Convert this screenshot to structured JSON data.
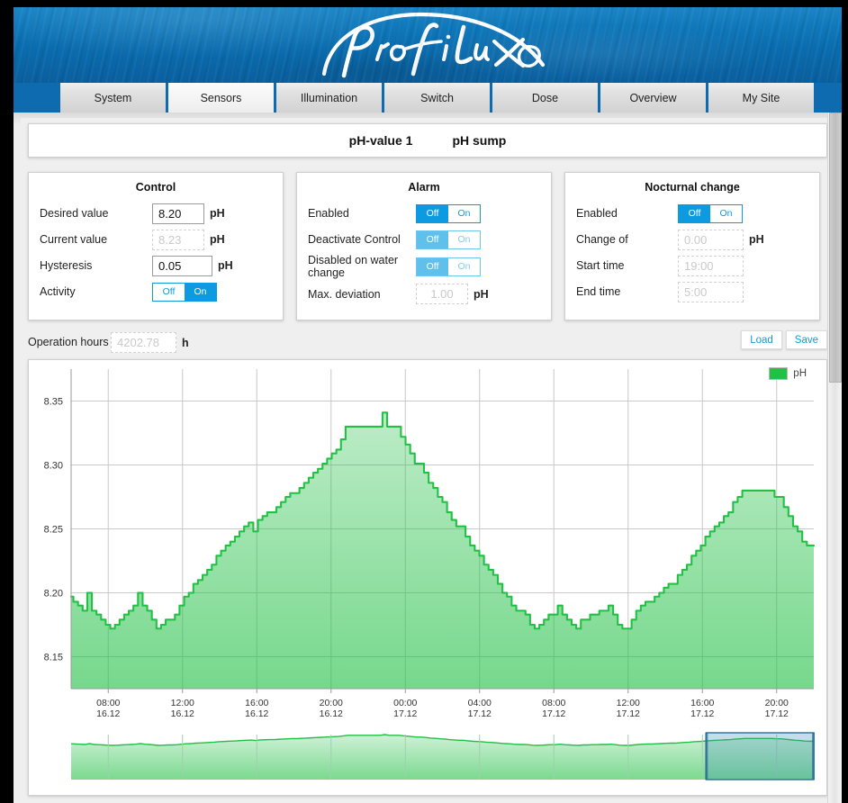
{
  "header": {
    "logo_text": "ProFiLux"
  },
  "tabs": [
    {
      "label": "System",
      "active": false
    },
    {
      "label": "Sensors",
      "active": true
    },
    {
      "label": "Illumination",
      "active": false
    },
    {
      "label": "Switch",
      "active": false
    },
    {
      "label": "Dose",
      "active": false
    },
    {
      "label": "Overview",
      "active": false
    },
    {
      "label": "My Site",
      "active": false
    }
  ],
  "title": {
    "sensor_name": "pH-value 1",
    "sensor_location": "pH sump"
  },
  "panels": {
    "control": {
      "title": "Control",
      "desired_label": "Desired value",
      "desired_value": "8.20",
      "desired_unit": "pH",
      "current_label": "Current value",
      "current_value": "8.23",
      "current_unit": "pH",
      "hysteresis_label": "Hysteresis",
      "hysteresis_value": "0.05",
      "hysteresis_unit": "pH",
      "activity_label": "Activity",
      "activity_off": "Off",
      "activity_on": "On",
      "activity_state": "On"
    },
    "alarm": {
      "title": "Alarm",
      "enabled_label": "Enabled",
      "enabled_off": "Off",
      "enabled_on": "On",
      "enabled_state": "Off",
      "deactivate_label": "Deactivate Control",
      "deactivate_off": "Off",
      "deactivate_on": "On",
      "deactivate_state": "Off",
      "waterchange_label": "Disabled on water change",
      "waterchange_off": "Off",
      "waterchange_on": "On",
      "waterchange_state": "Off",
      "deviation_label": "Max. deviation",
      "deviation_value": "1.00",
      "deviation_unit": "pH"
    },
    "nocturnal": {
      "title": "Nocturnal change",
      "enabled_label": "Enabled",
      "enabled_off": "Off",
      "enabled_on": "On",
      "enabled_state": "Off",
      "change_label": "Change of",
      "change_value": "0.00",
      "change_unit": "pH",
      "start_label": "Start time",
      "start_value": "19:00",
      "end_label": "End time",
      "end_value": "5:00"
    }
  },
  "operation": {
    "label": "Operation hours",
    "value": "4202.78",
    "unit": "h"
  },
  "buttons": {
    "load": "Load",
    "save": "Save"
  },
  "colors": {
    "accent_blue": "#0d9ae0",
    "banner_blue": "#0f6bb0",
    "series_green": "#22c045",
    "series_fill": "#8fdfa0",
    "navigator_selection": "#4f9fc4"
  },
  "chart_data": {
    "type": "area",
    "title": "",
    "xlabel": "",
    "ylabel": "",
    "grid": true,
    "legend": [
      {
        "name": "pH",
        "color": "#22c045"
      }
    ],
    "legend_position": "top-right",
    "ylim": [
      8.125,
      8.375
    ],
    "yticks": [
      "8.15",
      "8.20",
      "8.25",
      "8.30",
      "8.35"
    ],
    "ytick_values": [
      8.15,
      8.2,
      8.25,
      8.3,
      8.35
    ],
    "xticks": [
      {
        "time": "08:00",
        "date": "16.12"
      },
      {
        "time": "12:00",
        "date": "16.12"
      },
      {
        "time": "16:00",
        "date": "16.12"
      },
      {
        "time": "20:00",
        "date": "16.12"
      },
      {
        "time": "00:00",
        "date": "17.12"
      },
      {
        "time": "04:00",
        "date": "17.12"
      },
      {
        "time": "08:00",
        "date": "17.12"
      },
      {
        "time": "12:00",
        "date": "17.12"
      },
      {
        "time": "16:00",
        "date": "17.12"
      },
      {
        "time": "20:00",
        "date": "17.12"
      }
    ],
    "series": [
      {
        "name": "pH",
        "color": "#22c045",
        "values": [
          8.197,
          8.193,
          8.19,
          8.186,
          8.2,
          8.186,
          8.183,
          8.179,
          8.175,
          8.172,
          8.175,
          8.179,
          8.183,
          8.186,
          8.19,
          8.2,
          8.19,
          8.186,
          8.179,
          8.172,
          8.175,
          8.179,
          8.179,
          8.183,
          8.19,
          8.197,
          8.2,
          8.207,
          8.21,
          8.214,
          8.218,
          8.222,
          8.229,
          8.233,
          8.237,
          8.24,
          8.244,
          8.248,
          8.252,
          8.255,
          8.248,
          8.257,
          8.26,
          8.263,
          8.263,
          8.267,
          8.271,
          8.275,
          8.278,
          8.278,
          8.282,
          8.286,
          8.29,
          8.294,
          8.297,
          8.301,
          8.305,
          8.309,
          8.312,
          8.32,
          8.33,
          8.33,
          8.33,
          8.33,
          8.33,
          8.33,
          8.33,
          8.33,
          8.341,
          8.33,
          8.33,
          8.33,
          8.322,
          8.316,
          8.309,
          8.301,
          8.301,
          8.294,
          8.286,
          8.282,
          8.275,
          8.271,
          8.263,
          8.257,
          8.252,
          8.252,
          8.244,
          8.237,
          8.233,
          8.229,
          8.222,
          8.218,
          8.214,
          8.207,
          8.2,
          8.197,
          8.19,
          8.186,
          8.186,
          8.183,
          8.175,
          8.172,
          8.175,
          8.179,
          8.183,
          8.183,
          8.19,
          8.183,
          8.179,
          8.175,
          8.172,
          8.179,
          8.179,
          8.183,
          8.183,
          8.186,
          8.186,
          8.19,
          8.183,
          8.175,
          8.172,
          8.172,
          8.179,
          8.186,
          8.19,
          8.193,
          8.193,
          8.197,
          8.2,
          8.204,
          8.207,
          8.207,
          8.214,
          8.218,
          8.222,
          8.229,
          8.233,
          8.237,
          8.244,
          8.248,
          8.252,
          8.255,
          8.26,
          8.263,
          8.271,
          8.275,
          8.28,
          8.28,
          8.28,
          8.28,
          8.28,
          8.28,
          8.28,
          8.275,
          8.275,
          8.267,
          8.26,
          8.252,
          8.248,
          8.24,
          8.237,
          8.237
        ]
      }
    ],
    "navigator": {
      "selection_start_fraction": 0.855,
      "selection_end_fraction": 1.0
    }
  }
}
